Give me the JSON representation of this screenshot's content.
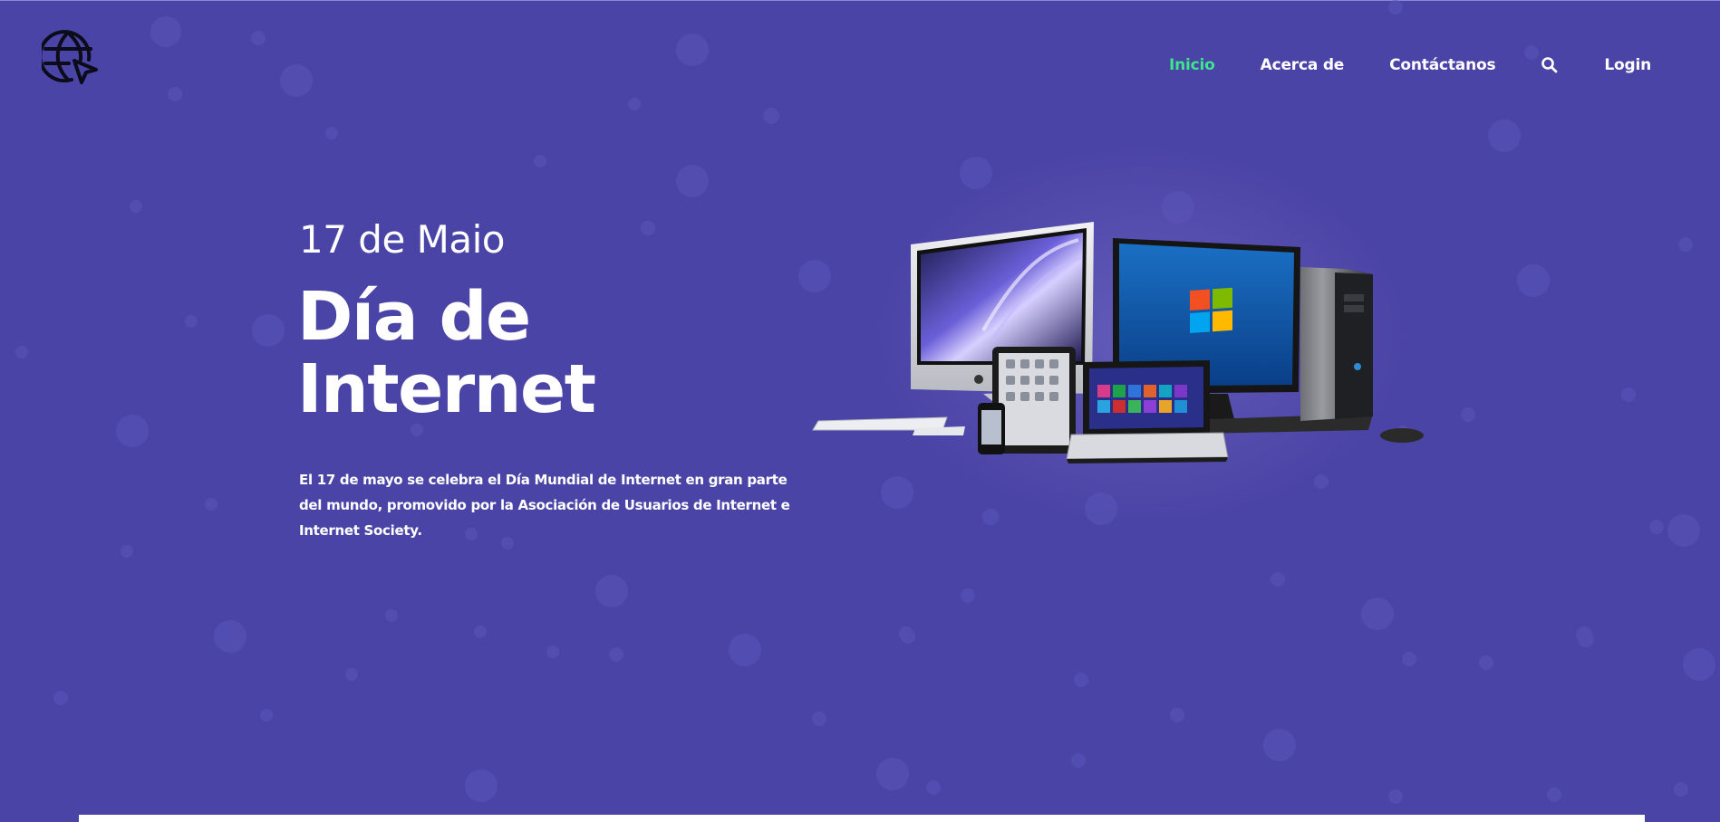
{
  "logo": {
    "icon": "globe-cursor-icon"
  },
  "nav": {
    "items": [
      {
        "label": "Inicio",
        "active": true
      },
      {
        "label": "Acerca de",
        "active": false
      },
      {
        "label": "Contáctanos",
        "active": false
      }
    ],
    "search_icon": "search-icon",
    "login_label": "Login",
    "active_color": "#3ee58c"
  },
  "hero": {
    "date": "17 de Maio",
    "title_line1": "Día de",
    "title_line2": "Internet",
    "description": "El 17 de mayo se celebra el Día Mundial de Internet en gran parte del mundo, promovido por la Asociación de Usuarios de Internet e Internet Society.",
    "background_color": "#4a44a6",
    "illustration": "computers-devices-image"
  }
}
